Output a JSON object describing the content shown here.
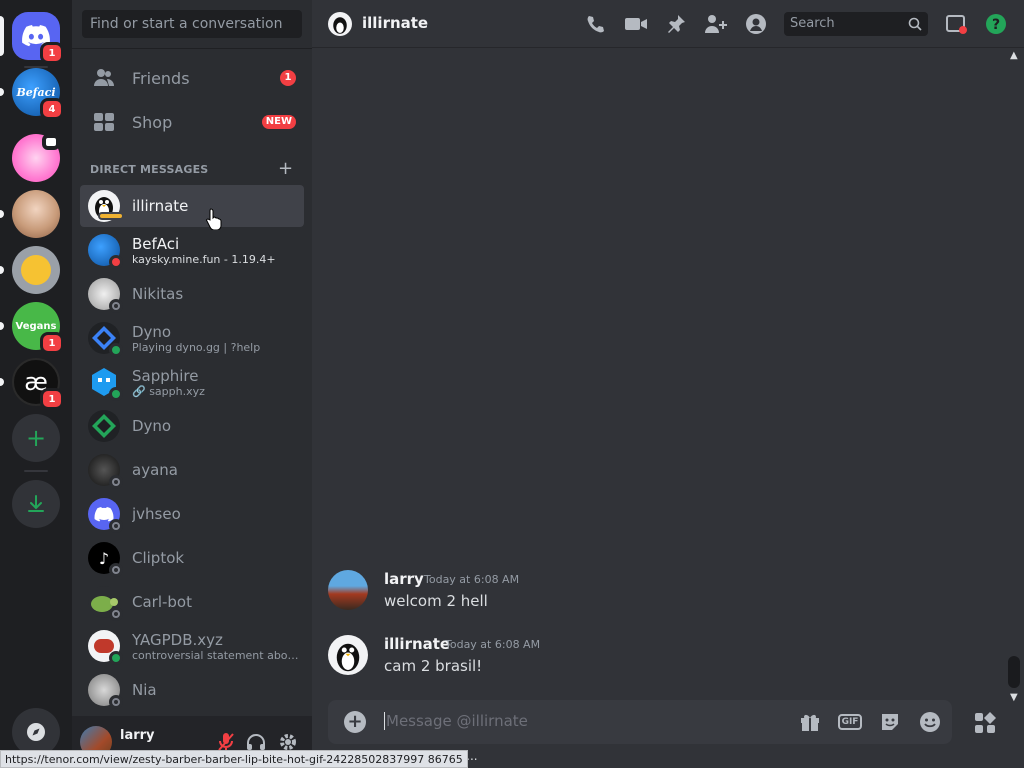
{
  "servers": {
    "home_badge": "1",
    "befaci_label": "Befaci",
    "befaci_badge": "4",
    "vegans_label": "Vegans",
    "vegans_badge": "1",
    "ae_label": "æ",
    "ae_badge": "1"
  },
  "dm_sidebar": {
    "search_placeholder": "Find or start a conversation",
    "friends_label": "Friends",
    "friends_badge": "1",
    "shop_label": "Shop",
    "shop_tag": "NEW",
    "dm_header": "DIRECT MESSAGES",
    "dms": [
      {
        "name": "illirnate",
        "sub": "",
        "status": "idle"
      },
      {
        "name": "BefAci",
        "sub": "kaysky.mine.fun - 1.19.4+",
        "status": "dnd"
      },
      {
        "name": "Nikitas",
        "sub": "",
        "status": "offline"
      },
      {
        "name": "Dyno",
        "sub": "Playing dyno.gg | ?help",
        "status": "online"
      },
      {
        "name": "Sapphire",
        "sub": "🔗 sapph.xyz",
        "status": "online"
      },
      {
        "name": "Dyno",
        "sub": "",
        "status": "none"
      },
      {
        "name": "ayana",
        "sub": "",
        "status": "offline"
      },
      {
        "name": "jvhseo",
        "sub": "",
        "status": "offline"
      },
      {
        "name": "Cliptok",
        "sub": "",
        "status": "offline"
      },
      {
        "name": "Carl-bot",
        "sub": "",
        "status": "offline"
      },
      {
        "name": "YAGPDB.xyz",
        "sub": "controversial statement abou...",
        "status": "online"
      },
      {
        "name": "Nia",
        "sub": "",
        "status": "offline"
      }
    ]
  },
  "user_panel": {
    "username": "larry"
  },
  "header": {
    "title": "illirnate",
    "search_placeholder": "Search"
  },
  "messages": [
    {
      "author": "larry",
      "time": "Today at 6:08 AM",
      "text": "welcom 2 hell"
    },
    {
      "author": "illirnate",
      "time": "Today at 6:08 AM",
      "text": "cam 2 brasil!"
    }
  ],
  "composer": {
    "placeholder": "Message @illirnate",
    "gif_label": "GIF"
  },
  "status_bar": {
    "url": "https://tenor.com/view/zesty-barber-barber-lip-bite-hot-gif-24228502837997 86765",
    "typing": "ping..."
  },
  "colors": {
    "blurple": "#5865f2",
    "red": "#f23f43",
    "green": "#23a559",
    "bg": "#313338",
    "sidebar": "#2b2d31",
    "rail": "#1e1f22"
  }
}
